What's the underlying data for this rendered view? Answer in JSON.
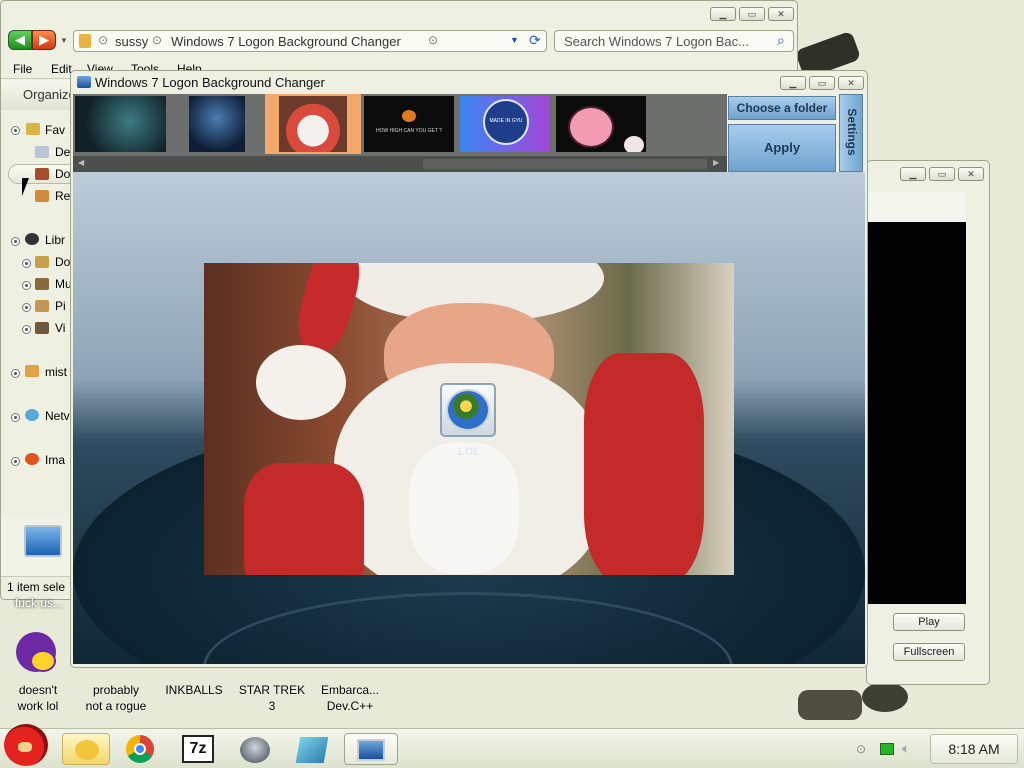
{
  "desktop": {
    "icons": [
      {
        "name": "fuck-us",
        "label": "fuck us..."
      },
      {
        "name": "yahoo",
        "label_lines": [
          "doesn't",
          "work lol"
        ]
      },
      {
        "name": "probably-not-a-rogue",
        "label_lines": [
          "probably",
          "not a rogue"
        ]
      },
      {
        "name": "inkballs",
        "label_lines": [
          "INKBALLS",
          ""
        ]
      },
      {
        "name": "star-trek",
        "label_lines": [
          "STAR TREK",
          "3"
        ]
      },
      {
        "name": "embarcadero",
        "label_lines": [
          "Embarca...",
          "Dev.C++"
        ]
      }
    ]
  },
  "browser": {
    "address_parts": [
      "sussy",
      "Windows 7 Logon Background Changer"
    ],
    "search_placeholder": "Search Windows 7 Logon Bac...",
    "menu": [
      "File",
      "Edit",
      "View",
      "Tools",
      "Help"
    ],
    "organize_label": "Organize",
    "status_text": "1 item sele",
    "tree": [
      {
        "label": "Fav",
        "level": 0
      },
      {
        "label": "De",
        "level": 1
      },
      {
        "label": "Do",
        "level": 1
      },
      {
        "label": "Re",
        "level": 1
      },
      {
        "label": "Libr",
        "level": 0
      },
      {
        "label": "Do",
        "level": 1
      },
      {
        "label": "Mu",
        "level": 1
      },
      {
        "label": "Pi",
        "level": 1
      },
      {
        "label": "Vi",
        "level": 1
      },
      {
        "label": "mist",
        "level": 0
      },
      {
        "label": "Netv",
        "level": 0
      },
      {
        "label": "Ima",
        "level": 0
      }
    ]
  },
  "app": {
    "title": "Windows 7 Logon Background Changer",
    "choose_folder": "Choose a folder",
    "apply": "Apply",
    "settings": "Settings",
    "thumbnails": [
      {
        "name": "dark-figure"
      },
      {
        "name": "warrior"
      },
      {
        "name": "santa",
        "selected": true
      },
      {
        "name": "how-high",
        "text": "HOW HIGH CAN YOU GET ?"
      },
      {
        "name": "made-in-gyu",
        "text": "MADE IN GYU"
      },
      {
        "name": "pink-pig"
      }
    ],
    "preview": {
      "user_label": "LOL"
    }
  },
  "player": {
    "play": "Play",
    "fullscreen": "Fullscreen"
  },
  "taskbar": {
    "clock": "8:18 AM"
  },
  "colors": {
    "apply_btn": "#7aaed2",
    "selected_thumb": "#f3a86c",
    "preview_bg_top": "#8da2b5",
    "preview_bg_bottom": "#0e2535"
  }
}
